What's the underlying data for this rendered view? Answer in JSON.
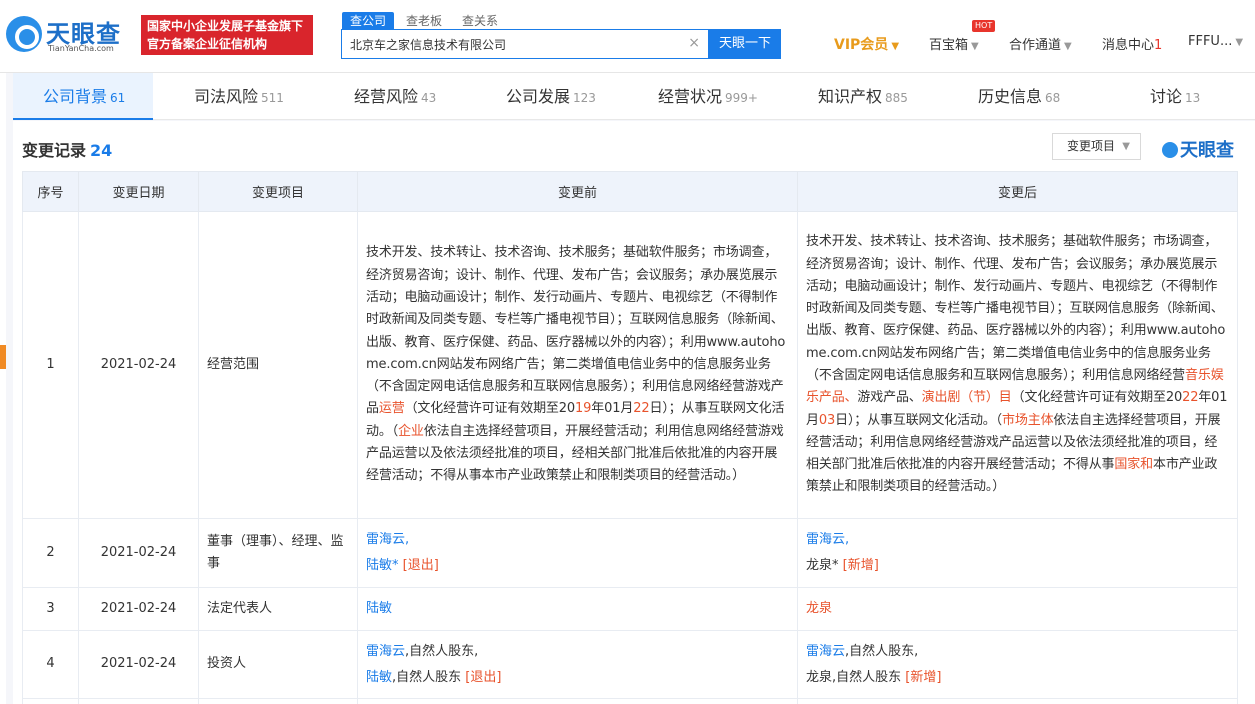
{
  "header": {
    "logo_name": "天眼查",
    "logo_sub": "TianYanCha.com",
    "slogan_line1": "国家中小企业发展子基金旗下",
    "slogan_line2": "官方备案企业征信机构",
    "search_tabs": [
      "查公司",
      "查老板",
      "查关系"
    ],
    "search_value": "北京车之家信息技术有限公司",
    "clear_icon": "×",
    "search_button": "天眼一下",
    "vip": "VIP会员",
    "hot": "HOT",
    "baibaoxiang": "百宝箱",
    "hezuo": "合作通道",
    "messages": "消息中心",
    "messages_count": "1",
    "user": "FFFU..."
  },
  "tabs": [
    {
      "label": "公司背景",
      "count": "61"
    },
    {
      "label": "司法风险",
      "count": "511"
    },
    {
      "label": "经营风险",
      "count": "43"
    },
    {
      "label": "公司发展",
      "count": "123"
    },
    {
      "label": "经营状况",
      "count": "999+"
    },
    {
      "label": "知识产权",
      "count": "885"
    },
    {
      "label": "历史信息",
      "count": "68"
    },
    {
      "label": "讨论",
      "count": "13"
    }
  ],
  "section": {
    "title": "变更记录",
    "count": "24",
    "filter_label": "变更项目",
    "watermark": "天眼查"
  },
  "table": {
    "headers": [
      "序号",
      "变更日期",
      "变更项目",
      "变更前",
      "变更后"
    ],
    "rows": [
      {
        "no": "1",
        "date": "2021-02-24",
        "item": "经营范围",
        "before": [
          {
            "t": "技术开发、技术转让、技术咨询、技术服务；基础软件服务；市场调查，经济贸易咨询；设计、制作、代理、发布广告；会议服务；承办展览展示活动；电脑动画设计；制作、发行动画片、专题片、电视综艺（不得制作时政新闻及同类专题、专栏等广播电视节目）；互联网信息服务（除新闻、出版、教育、医疗保健、药品、医疗器械以外的内容）；利用www.autohome.com.cn网站发布网络广告；第二类增值电信业务中的信息服务业务（不含固定网电话信息服务和互联网信息服务）；利用信息网络经营游戏产品"
          },
          {
            "t": "运营",
            "hl": true
          },
          {
            "t": "（文化经营许可证有效期至20"
          },
          {
            "t": "19",
            "hl": true
          },
          {
            "t": "年01月"
          },
          {
            "t": "22",
            "hl": true
          },
          {
            "t": "日）；从事互联网文化活动。（"
          },
          {
            "t": "企业",
            "hl": true
          },
          {
            "t": "依法自主选择经营项目，开展经营活动；利用信息网络经营游戏产品运营以及依法须经批准的项目，经相关部门批准后依批准的内容开展经营活动；不得从事本市产业政策禁止和限制类项目的经营活动。）"
          }
        ],
        "after": [
          {
            "t": "技术开发、技术转让、技术咨询、技术服务；基础软件服务；市场调查，经济贸易咨询；设计、制作、代理、发布广告；会议服务；承办展览展示活动；电脑动画设计；制作、发行动画片、专题片、电视综艺（不得制作时政新闻及同类专题、专栏等广播电视节目）；互联网信息服务（除新闻、出版、教育、医疗保健、药品、医疗器械以外的内容）；利用www.autohome.com.cn网站发布网络广告；第二类增值电信业务中的信息服务业务（不含固定网电话信息服务和互联网信息服务）；利用信息网络经营"
          },
          {
            "t": "音乐娱乐产品、",
            "hl": true
          },
          {
            "t": "游戏产品、"
          },
          {
            "t": "演出剧（节）目",
            "hl": true
          },
          {
            "t": "（文化经营许可证有效期至20"
          },
          {
            "t": "22",
            "hl": true
          },
          {
            "t": "年01月"
          },
          {
            "t": "03",
            "hl": true
          },
          {
            "t": "日）；从事互联网文化活动。（"
          },
          {
            "t": "市场主体",
            "hl": true
          },
          {
            "t": "依法自主选择经营项目，开展经营活动；利用信息网络经营游戏产品运营以及依法须经批准的项目，经相关部门批准后依批准的内容开展经营活动；不得从事"
          },
          {
            "t": "国家和",
            "hl": true
          },
          {
            "t": "本市产业政策禁止和限制类项目的经营活动。）"
          }
        ]
      },
      {
        "no": "2",
        "date": "2021-02-24",
        "item": "董事（理事）、经理、监事",
        "before_l1": "雷海云,",
        "before_l2_name": "陆敏*",
        "before_l2_tag": "[退出]",
        "after_l1": "雷海云,",
        "after_l2_name": "龙泉*",
        "after_l2_tag": "[新增]"
      },
      {
        "no": "3",
        "date": "2021-02-24",
        "item": "法定代表人",
        "before": "陆敏",
        "after": "龙泉"
      },
      {
        "no": "4",
        "date": "2021-02-24",
        "item": "投资人",
        "before_l1_name": "雷海云",
        "before_l1_rest": ",自然人股东,",
        "before_l2_name": "陆敏",
        "before_l2_rest": ",自然人股东",
        "before_l2_tag": "[退出]",
        "after_l1_name": "雷海云",
        "after_l1_rest": ",自然人股东,",
        "after_l2_name": "龙泉",
        "after_l2_rest": ",自然人股东",
        "after_l2_tag": "[新增]"
      }
    ]
  },
  "colors": {
    "brand": "#1a7ce8",
    "highlight": "#e8532c",
    "slogan_bg": "#d9252c",
    "vip": "#e89b1c"
  }
}
